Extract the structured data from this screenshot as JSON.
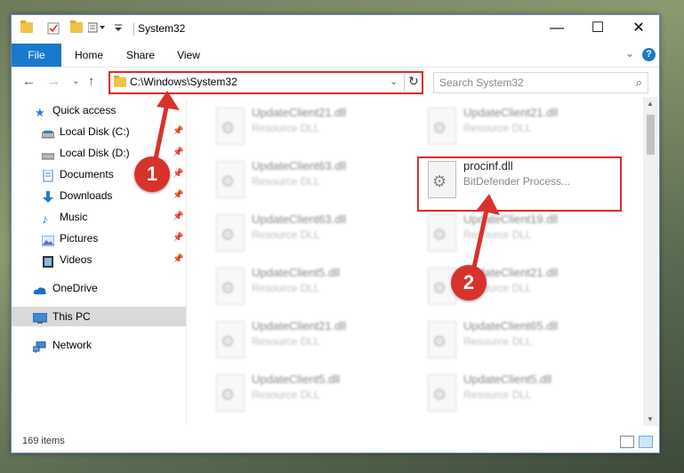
{
  "window": {
    "title": "System32",
    "minimize_glyph": "—",
    "maximize_glyph": "☐",
    "close_glyph": "✕"
  },
  "ribbon": {
    "tabs": [
      "File",
      "Home",
      "Share",
      "View"
    ],
    "help": "?"
  },
  "nav": {
    "address": "C:\\Windows\\System32",
    "search_placeholder": "Search System32"
  },
  "sidebar": {
    "items": [
      {
        "label": "Quick access",
        "icon": "star-icon"
      },
      {
        "label": "Local Disk (C:)",
        "icon": "drive-icon",
        "pinned": true
      },
      {
        "label": "Local Disk (D:)",
        "icon": "drive-icon",
        "pinned": true
      },
      {
        "label": "Documents",
        "icon": "documents-icon",
        "pinned": true
      },
      {
        "label": "Downloads",
        "icon": "downloads-icon",
        "pinned": true
      },
      {
        "label": "Music",
        "icon": "music-icon",
        "pinned": true
      },
      {
        "label": "Pictures",
        "icon": "pictures-icon",
        "pinned": true
      },
      {
        "label": "Videos",
        "icon": "videos-icon",
        "pinned": true
      },
      {
        "label": "OneDrive",
        "icon": "cloud-icon"
      },
      {
        "label": "This PC",
        "icon": "computer-icon",
        "selected": true
      },
      {
        "label": "Network",
        "icon": "network-icon"
      }
    ]
  },
  "files": {
    "left": [
      {
        "name": "UpdateClient21.dll",
        "type": "Resource DLL"
      },
      {
        "name": "UpdateClient63.dll",
        "type": "Resource DLL"
      },
      {
        "name": "UpdateClient63.dll",
        "type": "Resource DLL"
      },
      {
        "name": "UpdateClient5.dll",
        "type": "Resource DLL"
      },
      {
        "name": "UpdateClient21.dll",
        "type": "Resource DLL"
      },
      {
        "name": "UpdateClient5.dll",
        "type": "Resource DLL"
      }
    ],
    "right": [
      {
        "name": "UpdateClient21.dll",
        "type": "Resource DLL"
      },
      {
        "name": "procinf.dll",
        "type": "BitDefender Process..."
      },
      {
        "name": "UpdateClient19.dll",
        "type": "Resource DLL"
      },
      {
        "name": "UpdateClient21.dll",
        "type": "Resource DLL"
      },
      {
        "name": "UpdateClient65.dll",
        "type": "Resource DLL"
      },
      {
        "name": "UpdateClient5.dll",
        "type": "Resource DLL"
      }
    ],
    "highlighted": "procinf.dll"
  },
  "status": {
    "item_count": "169 items"
  },
  "annotations": {
    "badge1": "1",
    "badge2": "2",
    "color": "#d8322d"
  }
}
